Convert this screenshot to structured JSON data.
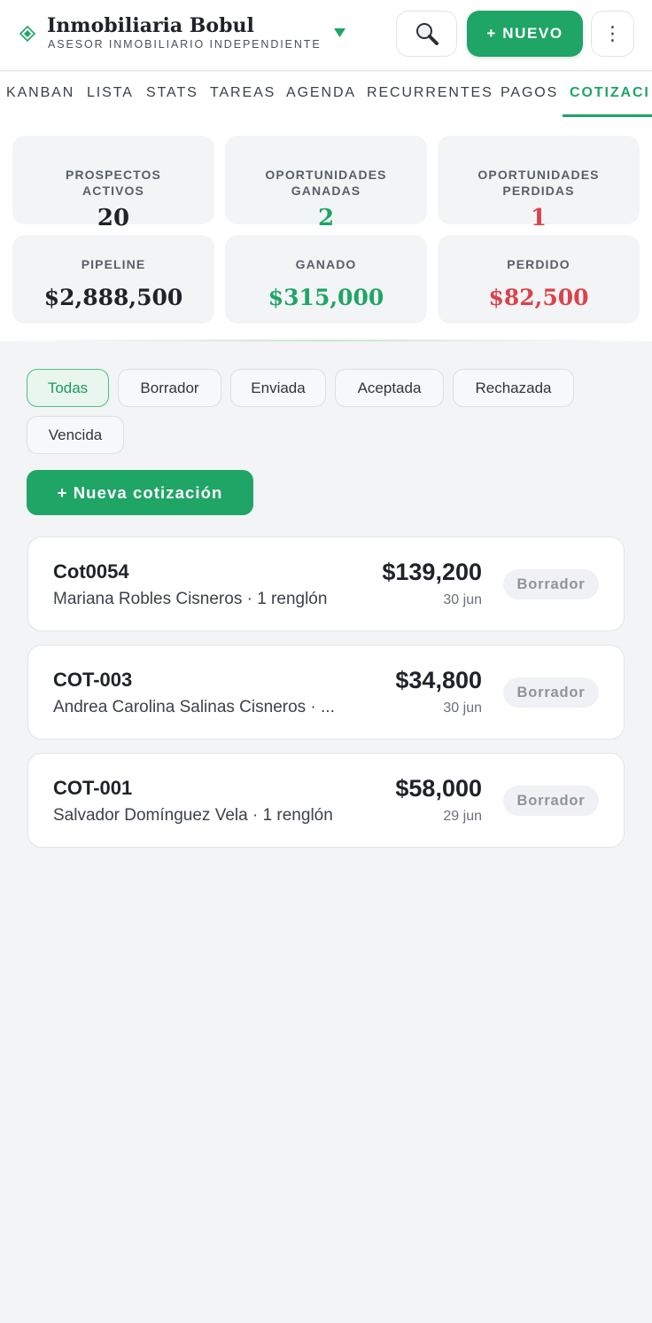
{
  "header": {
    "title": "Inmobiliaria Bobul",
    "subtitle": "ASESOR INMOBILIARIO INDEPENDIENTE",
    "new_label": "+ NUEVO",
    "more_glyph": "⋮",
    "brand_icon": "diamond-icon",
    "accent_color": "#1fa566"
  },
  "tabs": [
    {
      "label": "KANBAN"
    },
    {
      "label": "LISTA"
    },
    {
      "label": "STATS"
    },
    {
      "label": "TAREAS"
    },
    {
      "label": "AGENDA"
    },
    {
      "label": "RECURRENTES"
    },
    {
      "label": "PAGOS"
    },
    {
      "label": "COTIZACI",
      "active": true
    }
  ],
  "stats": [
    {
      "label_1": "PROSPECTOS",
      "label_2": "ACTIVOS",
      "value": "20",
      "color": "#1f2328"
    },
    {
      "label_1": "OPORTUNIDADES",
      "label_2": "GANADAS",
      "value": "2",
      "color": "#1fa566"
    },
    {
      "label_1": "OPORTUNIDADES",
      "label_2": "PERDIDAS",
      "value": "1",
      "color": "#d9434b"
    },
    {
      "label_1": "PIPELINE",
      "value": "$2,888,500",
      "color": "#1f2328"
    },
    {
      "label_1": "GANADO",
      "value": "$315,000",
      "color": "#1fa566"
    },
    {
      "label_1": "PERDIDO",
      "value": "$82,500",
      "color": "#d9434b"
    }
  ],
  "filters": [
    {
      "label": "Todas",
      "active": true
    },
    {
      "label": "Borrador"
    },
    {
      "label": "Enviada"
    },
    {
      "label": "Aceptada"
    },
    {
      "label": "Rechazada"
    },
    {
      "label": "Vencida"
    }
  ],
  "new_quote_label": "+ Nueva cotización",
  "quotes": [
    {
      "code": "Cot0054",
      "client": "Mariana Robles Cisneros · 1 renglón",
      "amount": "$139,200",
      "date": "30 jun",
      "status": "Borrador"
    },
    {
      "code": "COT-003",
      "client": "Andrea Carolina Salinas Cisneros · ...",
      "amount": "$34,800",
      "date": "30 jun",
      "status": "Borrador"
    },
    {
      "code": "COT-001",
      "client": "Salvador Domínguez Vela · 1 renglón",
      "amount": "$58,000",
      "date": "29 jun",
      "status": "Borrador"
    }
  ]
}
